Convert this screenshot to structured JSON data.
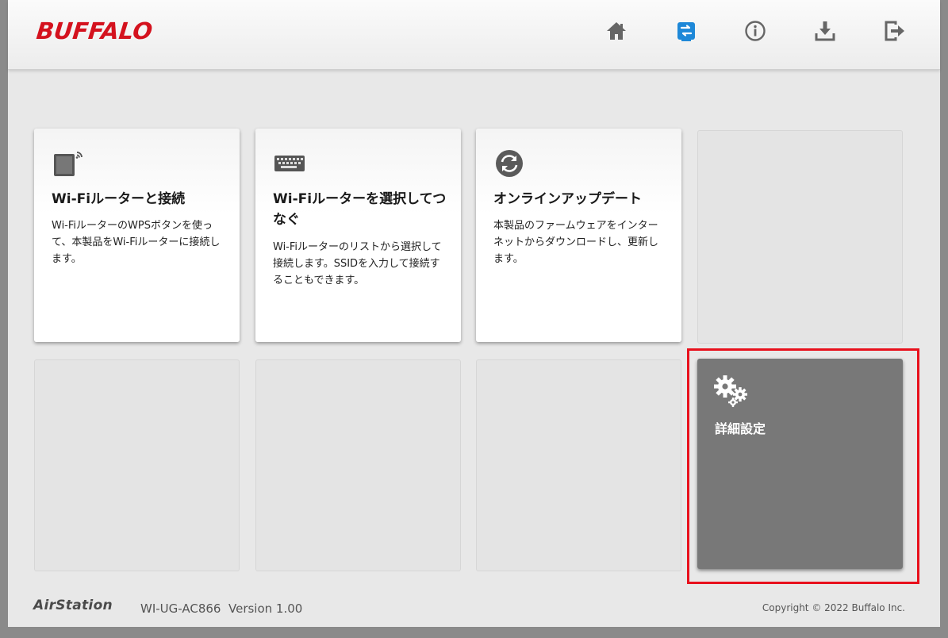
{
  "header": {
    "logo_text": "BUFFALO",
    "nav": [
      {
        "name": "home-icon"
      },
      {
        "name": "wifi-connect-icon",
        "active": true
      },
      {
        "name": "info-icon"
      },
      {
        "name": "download-icon"
      },
      {
        "name": "logout-icon"
      }
    ],
    "active_color": "#1e88d8",
    "icon_color": "#666666"
  },
  "tiles": [
    {
      "title": "Wi-Fiルーターと接続",
      "desc": "Wi-FiルーターのWPSボタンを使って、本製品をWi-Fiルーターに接続します。",
      "icon": "wps-router-icon"
    },
    {
      "title": "Wi-Fiルーターを選択してつなぐ",
      "desc": "Wi-Fiルーターのリストから選択して接続します。SSIDを入力して接続することもできます。",
      "icon": "keyboard-icon"
    },
    {
      "title": "オンラインアップデート",
      "desc": "本製品のファームウェアをインターネットからダウンロードし、更新します。",
      "icon": "refresh-icon"
    },
    {
      "title": "詳細設定",
      "icon": "gears-icon"
    }
  ],
  "footer": {
    "brand": "AirStation",
    "model": "WI-UG-AC866  Version 1.00",
    "copyright": "Copyright © 2022 Buffalo Inc."
  },
  "colors": {
    "brand_red": "#d4121e",
    "highlight_red": "#e8101c",
    "dark_tile": "#787878"
  }
}
